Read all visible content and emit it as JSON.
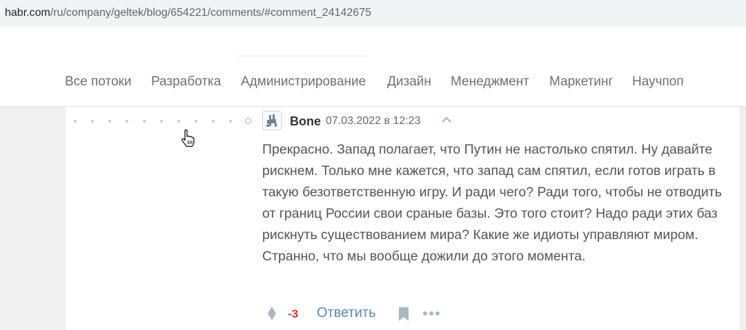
{
  "browser": {
    "url_host": "habr.com",
    "url_path": "/ru/company/geltek/blog/654221/comments/#comment_24142675"
  },
  "nav": {
    "items": [
      {
        "label": "Все потоки"
      },
      {
        "label": "Разработка"
      },
      {
        "label": "Администрирование"
      },
      {
        "label": "Дизайн"
      },
      {
        "label": "Менеджмент"
      },
      {
        "label": "Маркетинг"
      },
      {
        "label": "Научпоп"
      }
    ]
  },
  "comment": {
    "author": "Bone",
    "timestamp": "07.03.2022 в 12:23",
    "text": "Прекрасно. Запад полагает, что Путин не настолько спятил. Ну давайте рискнем. Только мне кажется, что запад сам спятил, если готов играть в такую безответственную игру. И ради чего? Ради того, чтобы не отводить от границ России свои сраные базы. Это того стоит? Надо ради этих баз рискнуть существованием мира? Какие же идиоты управляют миром. Странно, что мы вообще дожили до этого момента.",
    "score": "-3",
    "reply_label": "Ответить",
    "icons": [
      "vote-icon",
      "bookmark-icon",
      "more-icon",
      "collapse-icon"
    ]
  },
  "colors": {
    "score_negative": "#d4382f",
    "reply_link": "#548eaa",
    "nav_text": "#707070"
  }
}
